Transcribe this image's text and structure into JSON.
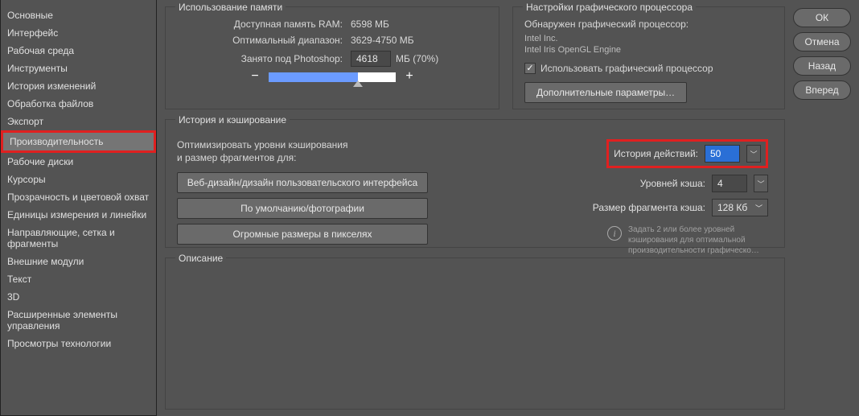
{
  "sidebar": {
    "items": [
      "Основные",
      "Интерфейс",
      "Рабочая среда",
      "Инструменты",
      "История изменений",
      "Обработка файлов",
      "Экспорт",
      "Производительность",
      "Рабочие диски",
      "Курсоры",
      "Прозрачность и цветовой охват",
      "Единицы измерения и линейки",
      "Направляющие, сетка и фрагменты",
      "Внешние модули",
      "Текст",
      "3D",
      "Расширенные элементы управления",
      "Просмотры технологии"
    ],
    "active_index": 7
  },
  "memory": {
    "title": "Использование памяти",
    "available_label": "Доступная память RAM:",
    "available_value": "6598 МБ",
    "ideal_label": "Оптимальный диапазон:",
    "ideal_value": "3629-4750 МБ",
    "used_label": "Занято под Photoshop:",
    "used_value": "4618",
    "used_suffix": "МБ (70%)",
    "slider_percent": 70
  },
  "gpu": {
    "title": "Настройки графического процессора",
    "detected_label": "Обнаружен графический процессор:",
    "vendor": "Intel Inc.",
    "engine": "Intel Iris OpenGL Engine",
    "use_gpu_label": "Использовать графический процессор",
    "use_gpu_checked": true,
    "advanced_label": "Дополнительные параметры…"
  },
  "history": {
    "title": "История и кэширование",
    "optimize_line1": "Оптимизировать уровни кэширования",
    "optimize_line2": "и размер фрагментов для:",
    "presets": [
      "Веб-дизайн/дизайн пользовательского интерфейса",
      "По умолчанию/фотографии",
      "Огромные размеры в пикселях"
    ],
    "history_states_label": "История действий:",
    "history_states_value": "50",
    "cache_levels_label": "Уровней кэша:",
    "cache_levels_value": "4",
    "tile_size_label": "Размер фрагмента кэша:",
    "tile_size_value": "128 Кб",
    "note": "Задать 2 или более уровней кэширования для оптимальной производительности графическо…"
  },
  "description": {
    "title": "Описание"
  },
  "buttons": {
    "ok": "ОК",
    "cancel": "Отмена",
    "back": "Назад",
    "forward": "Вперед"
  }
}
